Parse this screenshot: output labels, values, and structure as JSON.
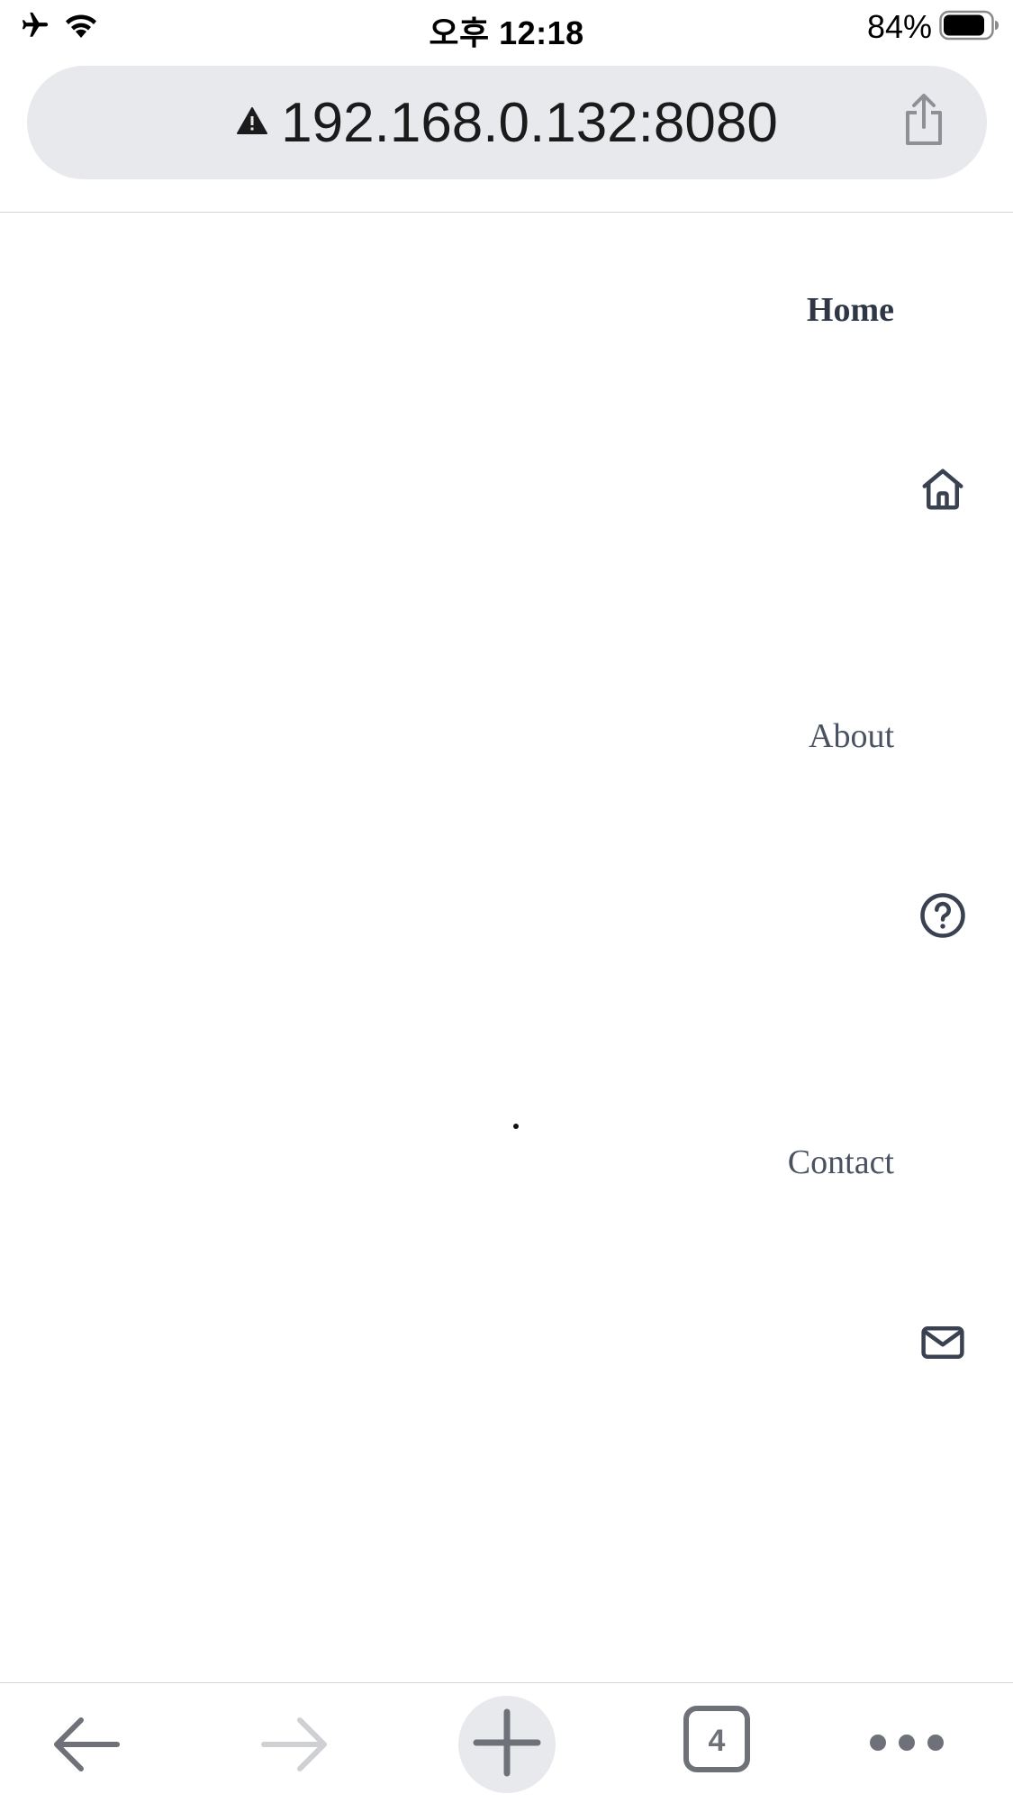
{
  "status_bar": {
    "time": "오후 12:18",
    "battery_percent": "84%",
    "icons": [
      "airplane-icon",
      "wifi-icon",
      "battery-icon"
    ]
  },
  "address_bar": {
    "url": "192.168.0.132:8080",
    "security_icon": "warning-triangle-icon",
    "share_icon": "share-icon"
  },
  "nav": {
    "items": [
      {
        "label": "Home",
        "icon": "home-icon",
        "active": true
      },
      {
        "label": "About",
        "icon": "question-circle-icon",
        "active": false
      },
      {
        "label": "Contact",
        "icon": "mail-icon",
        "active": false
      }
    ]
  },
  "toolbar": {
    "tab_count": "4",
    "icons": [
      "back-arrow-icon",
      "forward-arrow-icon",
      "plus-icon",
      "tabs-icon",
      "more-icon"
    ]
  },
  "colors": {
    "nav_text": "#3a4252",
    "icon_stroke": "#3a4252",
    "address_bg": "#e8e9ed",
    "toolbar_icon": "#6e7278",
    "toolbar_icon_disabled": "#cfd0d3"
  }
}
